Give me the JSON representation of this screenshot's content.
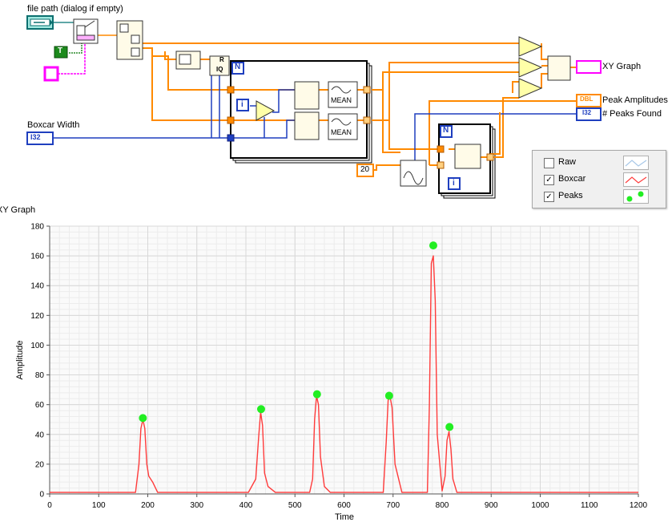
{
  "diagram": {
    "file_path_label": "file path (dialog if empty)",
    "boxcar_label": "Boxcar Width",
    "boxcar_type": "I32",
    "bool_constant": "T",
    "constant_20": "20",
    "xy_graph_label": "XY Graph",
    "peak_amplitudes_label": "Peak Amplitudes",
    "peaks_found_label": "# Peaks Found",
    "dbl_type": "DBL",
    "i32_type": "I32",
    "mean_label_1": "MEAN",
    "mean_label_2": "MEAN",
    "loop_n_1": "N",
    "loop_n_2": "N",
    "loop_i_1": "i",
    "loop_i_2": "i",
    "r_label": "R",
    "iq_label": "IQ"
  },
  "legend": {
    "items": [
      {
        "label": "Raw",
        "checked": false,
        "color": "#a8c8e8"
      },
      {
        "label": "Boxcar",
        "checked": true,
        "color": "#ff3b3b"
      },
      {
        "label": "Peaks",
        "checked": true,
        "color": "#22ee22"
      }
    ]
  },
  "graph": {
    "title": "XY Graph"
  },
  "chart_data": {
    "type": "line",
    "title": "XY Graph",
    "xlabel": "Time",
    "ylabel": "Amplitude",
    "xlim": [
      0,
      1200
    ],
    "ylim": [
      0,
      180
    ],
    "xticks": [
      0,
      100,
      200,
      300,
      400,
      500,
      600,
      700,
      800,
      900,
      1000,
      1100,
      1200
    ],
    "yticks": [
      0,
      20,
      40,
      60,
      80,
      100,
      120,
      140,
      160,
      180
    ],
    "grid": true,
    "series": [
      {
        "name": "Boxcar",
        "color": "#ff3b3b",
        "x": [
          0,
          100,
          175,
          182,
          186,
          190,
          194,
          198,
          202,
          210,
          220,
          300,
          405,
          420,
          426,
          430,
          434,
          438,
          445,
          460,
          530,
          536,
          540,
          544,
          548,
          552,
          560,
          572,
          680,
          686,
          690,
          694,
          698,
          704,
          718,
          770,
          774,
          778,
          782,
          786,
          790,
          800,
          806,
          810,
          814,
          818,
          822,
          830,
          1000,
          1200
        ],
        "y": [
          1,
          1,
          1,
          20,
          44,
          50,
          44,
          20,
          12,
          8,
          1,
          1,
          1,
          10,
          38,
          55,
          46,
          14,
          5,
          1,
          1,
          10,
          50,
          66,
          60,
          25,
          5,
          1,
          1,
          35,
          63,
          65,
          58,
          20,
          1,
          1,
          60,
          155,
          160,
          130,
          40,
          2,
          12,
          36,
          42,
          30,
          10,
          1,
          1,
          1
        ]
      },
      {
        "name": "Peaks",
        "color": "#22ee22",
        "x": [
          190,
          431,
          545,
          692,
          782,
          815
        ],
        "y": [
          51,
          57,
          67,
          66,
          167,
          45
        ]
      }
    ]
  }
}
